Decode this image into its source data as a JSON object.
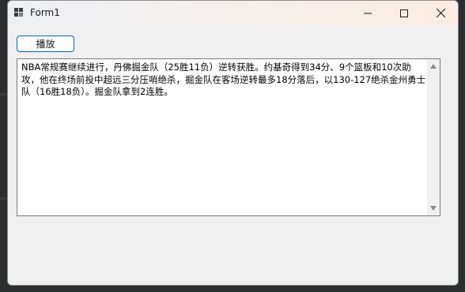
{
  "window": {
    "title": "Form1",
    "icon": "app-window-icon",
    "controls": [
      "minimize-icon",
      "maximize-icon",
      "close-icon"
    ]
  },
  "toolbar": {
    "play_label": "播放"
  },
  "textbox": {
    "content": "NBA常规赛继续进行，丹佛掘金队（25胜11负）逆转获胜。约基奇得到34分、9个篮板和10次助攻，他在终场前投中超远三分压哨绝杀，掘金队在客场逆转最多18分落后，以130-127绝杀金州勇士队（16胜18负）。掘金队拿到2连胜。"
  },
  "colors": {
    "accent": "#0067c0",
    "window_bg": "#f0f0f0",
    "textbox_bg": "#ffffff"
  }
}
